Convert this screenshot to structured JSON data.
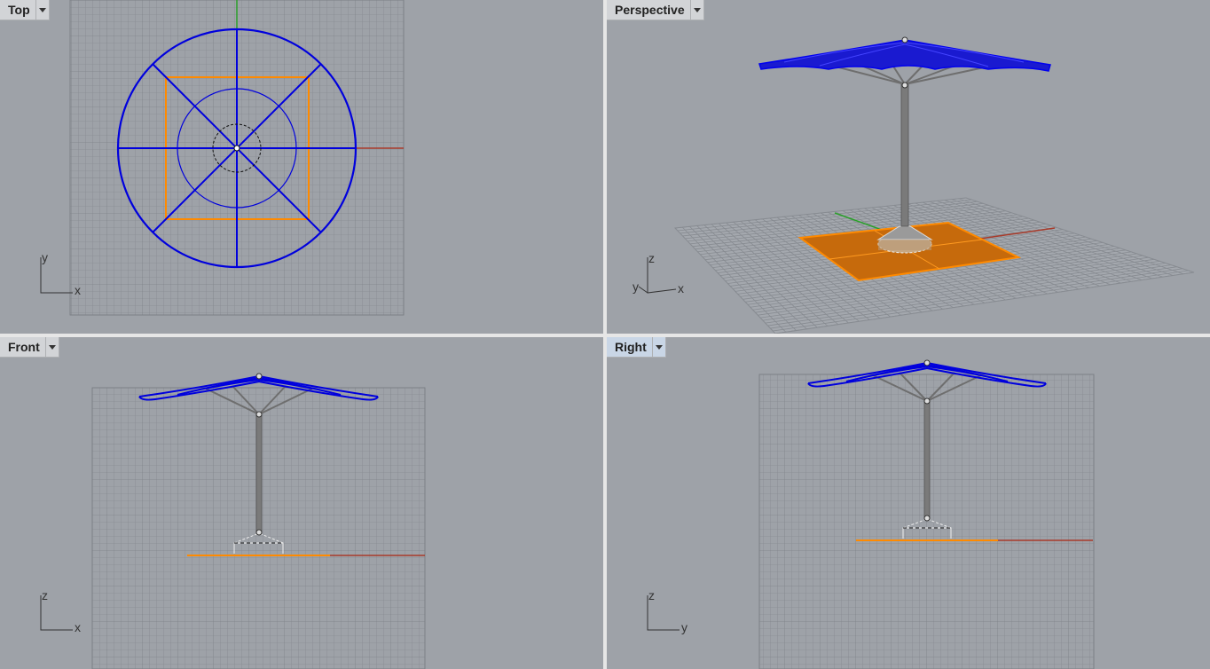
{
  "viewports": {
    "top": {
      "title": "Top",
      "axes": {
        "h": "x",
        "v": "y"
      }
    },
    "perspective": {
      "title": "Perspective",
      "axes": {
        "x": "x",
        "y": "y",
        "z": "z"
      }
    },
    "front": {
      "title": "Front",
      "axes": {
        "h": "x",
        "v": "z"
      }
    },
    "right": {
      "title": "Right",
      "axes": {
        "h": "y",
        "v": "z"
      }
    }
  },
  "colors": {
    "background": "#9ea2a8",
    "grid": "#878b91",
    "selected_curve": "#0000dd",
    "selected_base": "#ff8a00",
    "x_axis": "#a83a2a",
    "y_axis": "#2aa02a",
    "pole": "#6e6e6e"
  },
  "active_viewport": "right"
}
